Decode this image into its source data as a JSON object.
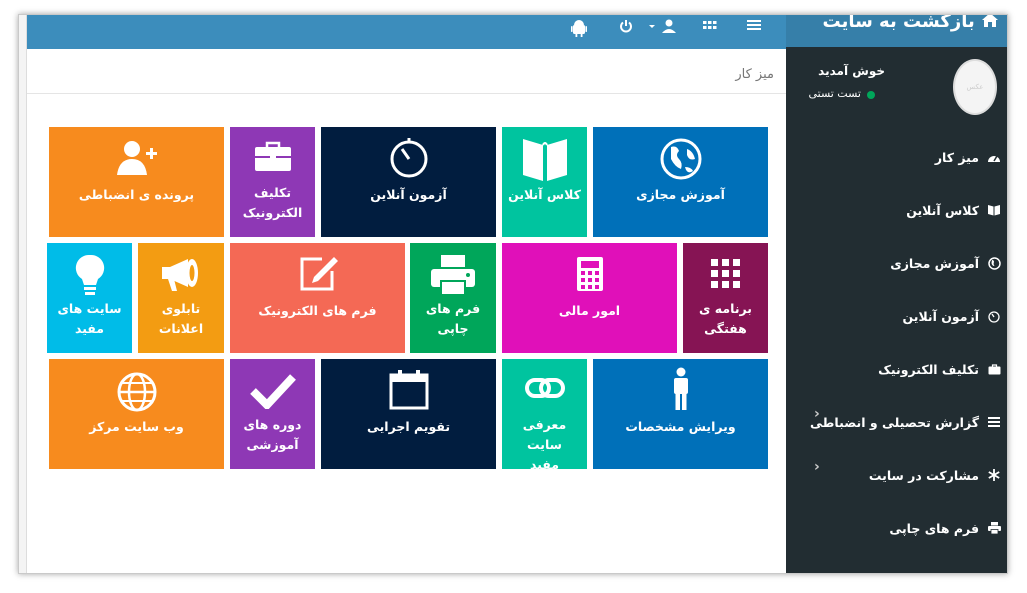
{
  "topbar": {
    "icons": [
      "android-icon",
      "power-icon",
      "user-dropdown-icon",
      "grid-icon",
      "menu-icon"
    ],
    "color": "#3c8dbc"
  },
  "page": {
    "title": "میز کار"
  },
  "tiles": [
    {
      "label": "پرونده ی انضباطی",
      "icon": "user-add-icon",
      "color": "#f78b1e"
    },
    {
      "label": "تکلیف\nالکترونیک",
      "icon": "briefcase-icon",
      "color": "#8e38b5"
    },
    {
      "label": "آزمون آنلاین",
      "icon": "timer-icon",
      "color": "#011d3f"
    },
    {
      "label": "کلاس آنلاین",
      "icon": "book-icon",
      "color": "#00c49f"
    },
    {
      "label": "آموزش مجازی",
      "icon": "globe-icon",
      "color": "#0070b9"
    },
    {
      "label": "سایت های\nمفید",
      "icon": "lightbulb-icon",
      "color": "#00bce8"
    },
    {
      "label": "تابلوی\nاعلانات",
      "icon": "megaphone-icon",
      "color": "#f39c12"
    },
    {
      "label": "فرم های الکترونیک",
      "icon": "edit-icon",
      "color": "#f46955"
    },
    {
      "label": "فرم های\nچاپی",
      "icon": "printer-icon",
      "color": "#00a65a"
    },
    {
      "label": "امور مالی",
      "icon": "calculator-icon",
      "color": "#e010b9"
    },
    {
      "label": "برنامه ی\nهفتگی",
      "icon": "grid-dots-icon",
      "color": "#861454"
    },
    {
      "label": "وب سایت مرکز",
      "icon": "world-icon",
      "color": "#f78b1e"
    },
    {
      "label": "دوره های\nآموزشی",
      "icon": "checkmark-icon",
      "color": "#8e38b5"
    },
    {
      "label": "تقویم اجرایی",
      "icon": "calendar-icon",
      "color": "#011d3f"
    },
    {
      "label": "معرفی سایت\nمفید",
      "icon": "link-icon",
      "color": "#00c49f"
    },
    {
      "label": "ویرایش مشخصات",
      "icon": "person-icon",
      "color": "#0070b9"
    }
  ],
  "sidebar": {
    "header": "بازگشت به سایت",
    "welcome": "خوش آمدید",
    "user_name": "تست تستی",
    "avatar_text": "عکس",
    "items": [
      {
        "label": "میز کار",
        "icon": "dashboard-icon",
        "chevron": false
      },
      {
        "label": "کلاس آنلاین",
        "icon": "book-icon",
        "chevron": false
      },
      {
        "label": "آموزش مجازی",
        "icon": "globe-icon",
        "chevron": false
      },
      {
        "label": "آزمون آنلاین",
        "icon": "timer-icon",
        "chevron": false
      },
      {
        "label": "تکلیف الکترونیک",
        "icon": "briefcase-icon",
        "chevron": false
      },
      {
        "label": "گزارش تحصیلی و انضباطی",
        "icon": "list-icon",
        "chevron": true
      },
      {
        "label": "مشارکت در سایت",
        "icon": "asterisk-icon",
        "chevron": true
      },
      {
        "label": "فرم های چاپی",
        "icon": "printer-icon",
        "chevron": false
      }
    ]
  }
}
